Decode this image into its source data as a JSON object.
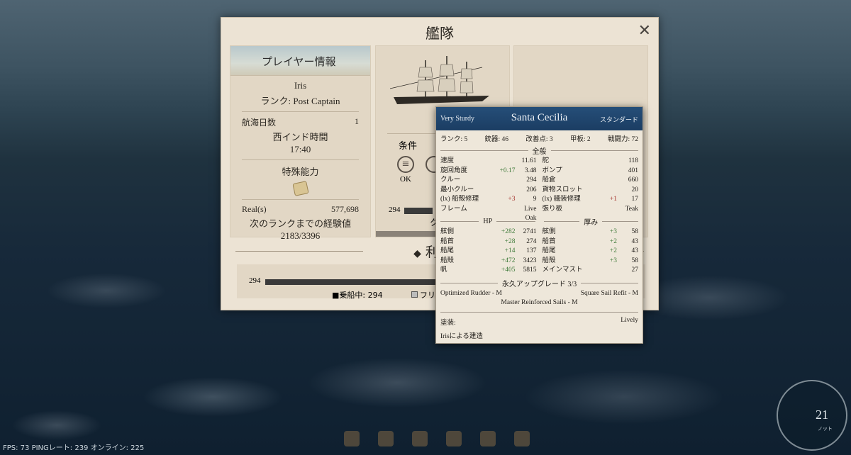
{
  "panel": {
    "title": "艦隊",
    "close": "✕"
  },
  "player": {
    "header": "プレイヤー情報",
    "name": "Iris",
    "rank": "ランク:  Post Captain",
    "sail_days_label": "航海日数",
    "sail_days_value": "1",
    "time_label": "西インド時間",
    "time_value": "17:40",
    "perks_label": "特殊能力",
    "reals_label": "Real(s)",
    "reals_value": "577,698",
    "next_rank_label": "次のランクまでの経験値",
    "exp_value": "2183/3396"
  },
  "fleet_ship": {
    "name_partial": "Santa",
    "conditions_label": "条件",
    "ok_label": "OK",
    "crew_count": "294",
    "crew_initial": "ク"
  },
  "available": {
    "title": "利用可",
    "crew_count": "294",
    "onboard_label": "■乗船中:  294",
    "free_label": "フリ"
  },
  "tooltip": {
    "durability": "Very Sturdy",
    "ship_name": "Santa Cecilia",
    "quality": "スタンダード",
    "top_stats": [
      "ランク: 5",
      "銃器: 46",
      "改善点: 3",
      "甲板: 2",
      "戦闘力: 72"
    ],
    "general_title": "全般",
    "general_left": [
      {
        "n": "速度",
        "b": "",
        "v": "11.61",
        "c": ""
      },
      {
        "n": "旋回角度",
        "b": "+0.17",
        "v": "3.48",
        "c": "pos"
      },
      {
        "n": "クルー",
        "b": "",
        "v": "294",
        "c": ""
      },
      {
        "n": "最小クルー",
        "b": "",
        "v": "206",
        "c": ""
      },
      {
        "n": "(lx) 船殻修理",
        "b": "+3",
        "v": "9",
        "c": "neg"
      },
      {
        "n": "フレーム",
        "b": "",
        "v": "Live Oak",
        "c": ""
      }
    ],
    "general_right": [
      {
        "n": "舵",
        "b": "",
        "v": "118",
        "c": ""
      },
      {
        "n": "ポンプ",
        "b": "",
        "v": "401",
        "c": ""
      },
      {
        "n": "船倉",
        "b": "",
        "v": "660",
        "c": ""
      },
      {
        "n": "貨物スロット",
        "b": "",
        "v": "20",
        "c": ""
      },
      {
        "n": "(lx) 艤装修理",
        "b": "+1",
        "v": "17",
        "c": "neg"
      },
      {
        "n": "張り板",
        "b": "",
        "v": "Teak",
        "c": ""
      }
    ],
    "hp_title": "HP",
    "thick_title": "厚み",
    "hp": [
      {
        "n": "舷側",
        "b": "+282",
        "v": "2741"
      },
      {
        "n": "船首",
        "b": "+28",
        "v": "274"
      },
      {
        "n": "船尾",
        "b": "+14",
        "v": "137"
      },
      {
        "n": "船殻",
        "b": "+472",
        "v": "3423"
      },
      {
        "n": "帆",
        "b": "+405",
        "v": "5815"
      }
    ],
    "thickness": [
      {
        "n": "舷側",
        "b": "+3",
        "v": "58"
      },
      {
        "n": "船首",
        "b": "+2",
        "v": "43"
      },
      {
        "n": "船尾",
        "b": "+2",
        "v": "43"
      },
      {
        "n": "船殻",
        "b": "+3",
        "v": "58"
      },
      {
        "n": "メインマスト",
        "b": "",
        "v": "27"
      }
    ],
    "upgrades_title": "永久アップグレード 3/3",
    "upgrades": [
      "Optimized Rudder - M",
      "Square Sail Refit - M",
      "Master Reinforced Sails - M"
    ],
    "paint_label": "塗装:",
    "paint_value": "Lively",
    "builder": "Irisによる建造"
  },
  "hud": {
    "fps": "FPS: 73   PINGレート:  239  オンライン:  225",
    "speed": "21",
    "speed_unit": "ノット"
  }
}
